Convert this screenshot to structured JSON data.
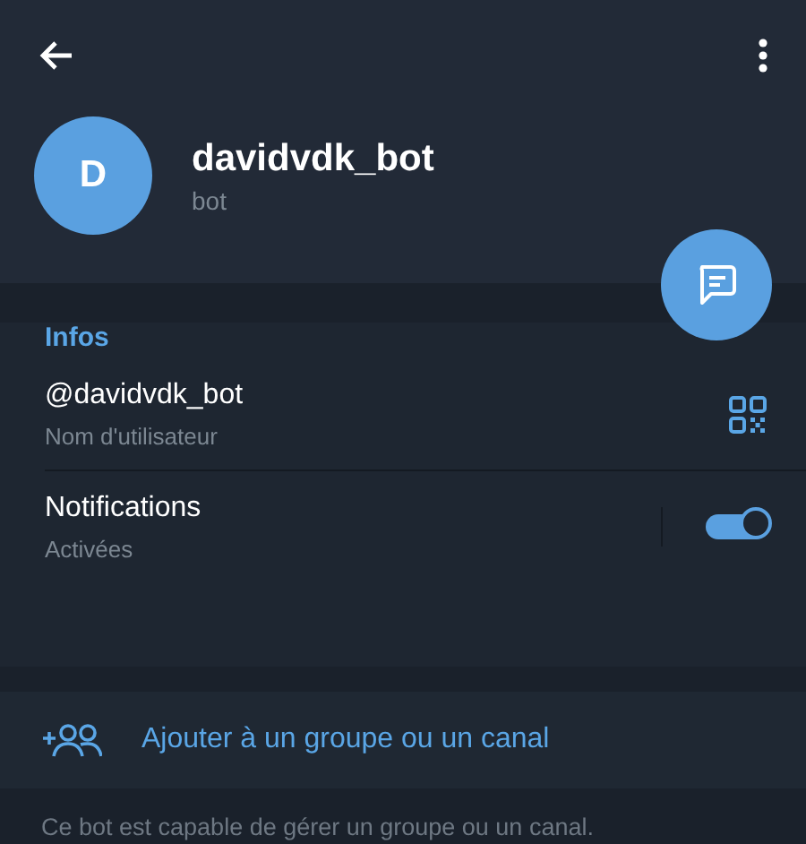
{
  "profile": {
    "avatar_letter": "D",
    "name": "davidvdk_bot",
    "status": "bot"
  },
  "info": {
    "heading": "Infos",
    "username": "@davidvdk_bot",
    "username_caption": "Nom d'utilisateur",
    "notifications_label": "Notifications",
    "notifications_caption": "Activées",
    "notifications_on": true
  },
  "add_action": {
    "label": "Ajouter à un groupe ou un canal"
  },
  "footer_note": "Ce bot est capable de gérer un groupe ou un canal."
}
